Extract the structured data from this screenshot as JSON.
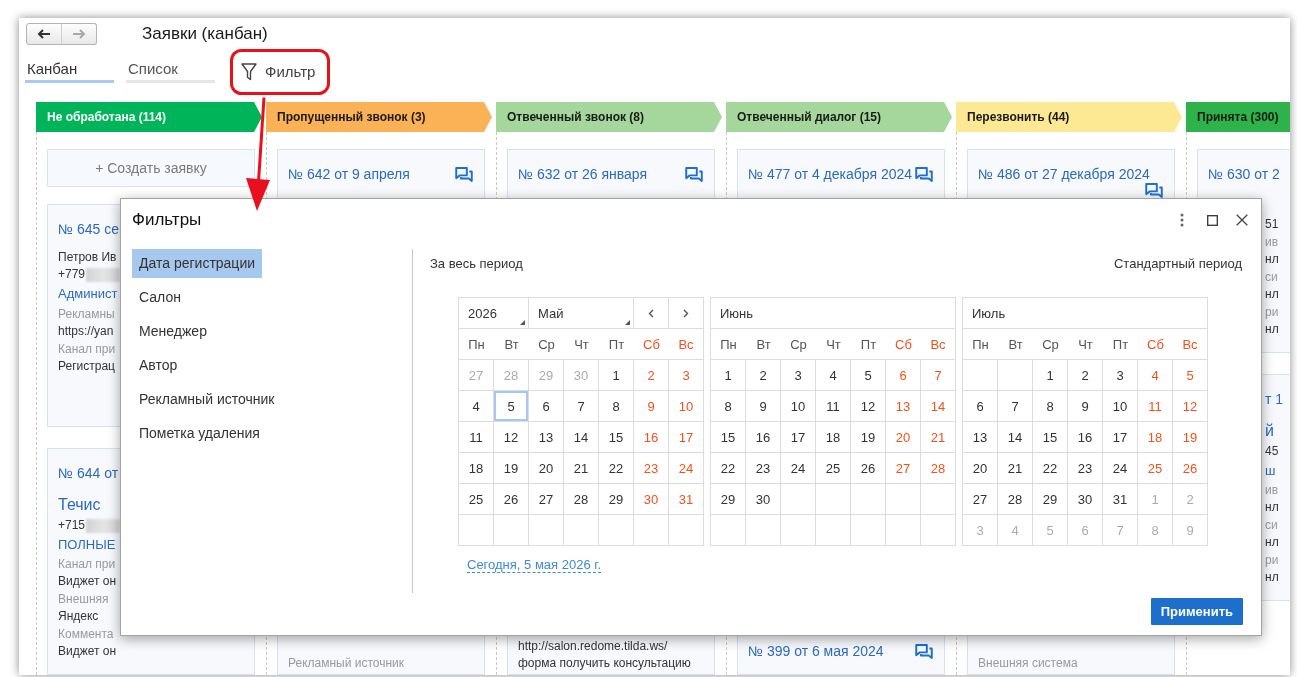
{
  "window": {
    "title": "Заявки (канбан)"
  },
  "nav_buttons": [
    {
      "kind": "back",
      "disabled": false
    },
    {
      "kind": "forward",
      "disabled": true
    }
  ],
  "tabs": [
    {
      "label": "Канбан",
      "selected": true
    },
    {
      "label": "Список",
      "selected": false
    }
  ],
  "filter_button": {
    "label": "Фильтр"
  },
  "columns": [
    {
      "title": "Не обработана (114)",
      "color": "#00b45a",
      "light_text": true,
      "create_button": "+ Создать заявку",
      "cards": [
        {
          "title": "№ 645 се",
          "lines": [
            {
              "kind": "name",
              "text": "Петров Ив"
            },
            {
              "kind": "phone",
              "text": "+779"
            },
            {
              "kind": "link",
              "text": "Админист"
            },
            {
              "kind": "caption",
              "text": "Рекламны"
            },
            {
              "kind": "value",
              "text": "https://yan"
            },
            {
              "kind": "caption",
              "text": "Канал при"
            },
            {
              "kind": "value",
              "text": "Регистрац"
            }
          ]
        },
        {
          "title": "№ 644 от",
          "lines": [
            {
              "kind": "company",
              "text": "Течис"
            },
            {
              "kind": "phone",
              "text": "+715"
            },
            {
              "kind": "tag",
              "text": "ПОЛНЫЕ"
            },
            {
              "kind": "caption",
              "text": "Канал при"
            },
            {
              "kind": "value",
              "text": "Виджет он"
            },
            {
              "kind": "caption",
              "text": "Внешняя"
            },
            {
              "kind": "value",
              "text": "Яндекс"
            },
            {
              "kind": "caption",
              "text": "Коммента"
            },
            {
              "kind": "value",
              "text": "Виджет он"
            }
          ]
        }
      ]
    },
    {
      "title": "Пропущенный звонок (3)",
      "color": "#fbb155",
      "light_text": false,
      "cards": [
        {
          "title": "№ 642 от 9 апреля",
          "chat": true,
          "lines": [
            {
              "kind": "caption",
              "text": "Рекламный источник"
            }
          ]
        }
      ]
    },
    {
      "title": "Отвеченный звонок (8)",
      "color": "#a5d69c",
      "light_text": false,
      "cards": [
        {
          "title": "№ 632 от 26 января",
          "chat": true,
          "lines": [
            {
              "kind": "value",
              "text": "http://salon.redome.tilda.ws/"
            },
            {
              "kind": "value",
              "text": "форма получить консультацию"
            }
          ]
        }
      ]
    },
    {
      "title": "Отвеченный диалог (15)",
      "color": "#a5d69c",
      "light_text": false,
      "cards": [
        {
          "title": "№ 477 от 4 декабря 2024",
          "chat": true
        },
        {
          "title": "№ 399 от 6 мая 2024",
          "chat": true
        }
      ]
    },
    {
      "title": "Перезвонить (44)",
      "color": "#fde994",
      "light_text": false,
      "cards": [
        {
          "title": "№ 486 от 27 декабря 2024",
          "chat": true,
          "lines": [
            {
              "kind": "caption",
              "text": "Внешняя система"
            }
          ]
        }
      ]
    },
    {
      "title": "Принята (300)",
      "color": "#2db34a",
      "light_text": false,
      "cards": [
        {
          "title": "№ 630 от 2",
          "lines": [
            {
              "kind": "value",
              "text": "51"
            },
            {
              "kind": "caption",
              "text": "ив"
            },
            {
              "kind": "value",
              "text": "нл"
            },
            {
              "kind": "caption",
              "text": "си"
            },
            {
              "kind": "value",
              "text": "нл"
            },
            {
              "kind": "caption",
              "text": "ри"
            },
            {
              "kind": "value",
              "text": "нл"
            }
          ]
        },
        {
          "lines": [
            {
              "kind": "title",
              "text": "т 1"
            },
            {
              "kind": "company",
              "text": "й"
            },
            {
              "kind": "value",
              "text": "45"
            },
            {
              "kind": "tag",
              "text": "ш"
            },
            {
              "kind": "caption",
              "text": "ив"
            },
            {
              "kind": "value",
              "text": "нл"
            },
            {
              "kind": "caption",
              "text": "си"
            },
            {
              "kind": "value",
              "text": "нл"
            },
            {
              "kind": "caption",
              "text": "ри"
            },
            {
              "kind": "value",
              "text": "нл"
            }
          ]
        }
      ]
    }
  ],
  "dialog": {
    "title": "Фильтры",
    "sections": [
      {
        "label": "Дата регистрации",
        "selected": true
      },
      {
        "label": "Салон",
        "selected": false
      },
      {
        "label": "Менеджер",
        "selected": false
      },
      {
        "label": "Автор",
        "selected": false
      },
      {
        "label": "Рекламный источник",
        "selected": false
      },
      {
        "label": "Пометка удаления",
        "selected": false
      }
    ],
    "period_all": "За весь период",
    "period_standard": "Стандартный период",
    "months": [
      {
        "kind": "picker",
        "year": "2026",
        "name": "Май",
        "weekdays": [
          {
            "label": "Пн",
            "weekend": false
          },
          {
            "label": "Вт",
            "weekend": false
          },
          {
            "label": "Ср",
            "weekend": false
          },
          {
            "label": "Чт",
            "weekend": false
          },
          {
            "label": "Пт",
            "weekend": false
          },
          {
            "label": "Сб",
            "weekend": true
          },
          {
            "label": "Вс",
            "weekend": true
          }
        ],
        "weeks": [
          [
            {
              "day": "27",
              "muted": true,
              "selected": false
            },
            {
              "day": "28",
              "muted": true,
              "selected": false
            },
            {
              "day": "29",
              "muted": true,
              "selected": false
            },
            {
              "day": "30",
              "muted": true,
              "selected": false
            },
            {
              "day": "1",
              "muted": false,
              "selected": false
            },
            {
              "day": "2",
              "muted": false,
              "selected": false
            },
            {
              "day": "3",
              "muted": false,
              "selected": false
            }
          ],
          [
            {
              "day": "4",
              "muted": false,
              "selected": false
            },
            {
              "day": "5",
              "muted": false,
              "selected": true
            },
            {
              "day": "6",
              "muted": false,
              "selected": false
            },
            {
              "day": "7",
              "muted": false,
              "selected": false
            },
            {
              "day": "8",
              "muted": false,
              "selected": false
            },
            {
              "day": "9",
              "muted": false,
              "selected": false
            },
            {
              "day": "10",
              "muted": false,
              "selected": false
            }
          ],
          [
            {
              "day": "11",
              "muted": false,
              "selected": false
            },
            {
              "day": "12",
              "muted": false,
              "selected": false
            },
            {
              "day": "13",
              "muted": false,
              "selected": false
            },
            {
              "day": "14",
              "muted": false,
              "selected": false
            },
            {
              "day": "15",
              "muted": false,
              "selected": false
            },
            {
              "day": "16",
              "muted": false,
              "selected": false
            },
            {
              "day": "17",
              "muted": false,
              "selected": false
            }
          ],
          [
            {
              "day": "18",
              "muted": false,
              "selected": false
            },
            {
              "day": "19",
              "muted": false,
              "selected": false
            },
            {
              "day": "20",
              "muted": false,
              "selected": false
            },
            {
              "day": "21",
              "muted": false,
              "selected": false
            },
            {
              "day": "22",
              "muted": false,
              "selected": false
            },
            {
              "day": "23",
              "muted": false,
              "selected": false
            },
            {
              "day": "24",
              "muted": false,
              "selected": false
            }
          ],
          [
            {
              "day": "25",
              "muted": false,
              "selected": false
            },
            {
              "day": "26",
              "muted": false,
              "selected": false
            },
            {
              "day": "27",
              "muted": false,
              "selected": false
            },
            {
              "day": "28",
              "muted": false,
              "selected": false
            },
            {
              "day": "29",
              "muted": false,
              "selected": false
            },
            {
              "day": "30",
              "muted": false,
              "selected": false
            },
            {
              "day": "31",
              "muted": false,
              "selected": false
            }
          ]
        ]
      },
      {
        "kind": "plain",
        "name": "Июнь",
        "weekdays": [
          {
            "label": "Пн",
            "weekend": false
          },
          {
            "label": "Вт",
            "weekend": false
          },
          {
            "label": "Ср",
            "weekend": false
          },
          {
            "label": "Чт",
            "weekend": false
          },
          {
            "label": "Пт",
            "weekend": false
          },
          {
            "label": "Сб",
            "weekend": true
          },
          {
            "label": "Вс",
            "weekend": true
          }
        ],
        "weeks": [
          [
            {
              "day": "1",
              "muted": false,
              "selected": false
            },
            {
              "day": "2",
              "muted": false,
              "selected": false
            },
            {
              "day": "3",
              "muted": false,
              "selected": false
            },
            {
              "day": "4",
              "muted": false,
              "selected": false
            },
            {
              "day": "5",
              "muted": false,
              "selected": false
            },
            {
              "day": "6",
              "muted": false,
              "selected": false
            },
            {
              "day": "7",
              "muted": false,
              "selected": false
            }
          ],
          [
            {
              "day": "8",
              "muted": false,
              "selected": false
            },
            {
              "day": "9",
              "muted": false,
              "selected": false
            },
            {
              "day": "10",
              "muted": false,
              "selected": false
            },
            {
              "day": "11",
              "muted": false,
              "selected": false
            },
            {
              "day": "12",
              "muted": false,
              "selected": false
            },
            {
              "day": "13",
              "muted": false,
              "selected": false
            },
            {
              "day": "14",
              "muted": false,
              "selected": false
            }
          ],
          [
            {
              "day": "15",
              "muted": false,
              "selected": false
            },
            {
              "day": "16",
              "muted": false,
              "selected": false
            },
            {
              "day": "17",
              "muted": false,
              "selected": false
            },
            {
              "day": "18",
              "muted": false,
              "selected": false
            },
            {
              "day": "19",
              "muted": false,
              "selected": false
            },
            {
              "day": "20",
              "muted": false,
              "selected": false
            },
            {
              "day": "21",
              "muted": false,
              "selected": false
            }
          ],
          [
            {
              "day": "22",
              "muted": false,
              "selected": false
            },
            {
              "day": "23",
              "muted": false,
              "selected": false
            },
            {
              "day": "24",
              "muted": false,
              "selected": false
            },
            {
              "day": "25",
              "muted": false,
              "selected": false
            },
            {
              "day": "26",
              "muted": false,
              "selected": false
            },
            {
              "day": "27",
              "muted": false,
              "selected": false
            },
            {
              "day": "28",
              "muted": false,
              "selected": false
            }
          ],
          [
            {
              "day": "29",
              "muted": false,
              "selected": false
            },
            {
              "day": "30",
              "muted": false,
              "selected": false
            }
          ]
        ]
      },
      {
        "kind": "plain",
        "name": "Июль",
        "weekdays": [
          {
            "label": "Пн",
            "weekend": false
          },
          {
            "label": "Вт",
            "weekend": false
          },
          {
            "label": "Ср",
            "weekend": false
          },
          {
            "label": "Чт",
            "weekend": false
          },
          {
            "label": "Пт",
            "weekend": false
          },
          {
            "label": "Сб",
            "weekend": true
          },
          {
            "label": "Вс",
            "weekend": true
          }
        ],
        "weeks": [
          [
            {
              "day": "1",
              "muted": false,
              "selected": false
            },
            {
              "day": "2",
              "muted": false,
              "selected": false
            },
            {
              "day": "3",
              "muted": false,
              "selected": false
            },
            {
              "day": "4",
              "muted": false,
              "selected": false
            },
            {
              "day": "5",
              "muted": false,
              "selected": false
            }
          ],
          [
            {
              "day": "6",
              "muted": false,
              "selected": false
            },
            {
              "day": "7",
              "muted": false,
              "selected": false
            },
            {
              "day": "8",
              "muted": false,
              "selected": false
            },
            {
              "day": "9",
              "muted": false,
              "selected": false
            },
            {
              "day": "10",
              "muted": false,
              "selected": false
            },
            {
              "day": "11",
              "muted": false,
              "selected": false
            },
            {
              "day": "12",
              "muted": false,
              "selected": false
            }
          ],
          [
            {
              "day": "13",
              "muted": false,
              "selected": false
            },
            {
              "day": "14",
              "muted": false,
              "selected": false
            },
            {
              "day": "15",
              "muted": false,
              "selected": false
            },
            {
              "day": "16",
              "muted": false,
              "selected": false
            },
            {
              "day": "17",
              "muted": false,
              "selected": false
            },
            {
              "day": "18",
              "muted": false,
              "selected": false
            },
            {
              "day": "19",
              "muted": false,
              "selected": false
            }
          ],
          [
            {
              "day": "20",
              "muted": false,
              "selected": false
            },
            {
              "day": "21",
              "muted": false,
              "selected": false
            },
            {
              "day": "22",
              "muted": false,
              "selected": false
            },
            {
              "day": "23",
              "muted": false,
              "selected": false
            },
            {
              "day": "24",
              "muted": false,
              "selected": false
            },
            {
              "day": "25",
              "muted": false,
              "selected": false
            },
            {
              "day": "26",
              "muted": false,
              "selected": false
            }
          ],
          [
            {
              "day": "27",
              "muted": false,
              "selected": false
            },
            {
              "day": "28",
              "muted": false,
              "selected": false
            },
            {
              "day": "29",
              "muted": false,
              "selected": false
            },
            {
              "day": "30",
              "muted": false,
              "selected": false
            },
            {
              "day": "31",
              "muted": false,
              "selected": false
            },
            {
              "day": "1",
              "muted": true,
              "selected": false
            },
            {
              "day": "2",
              "muted": true,
              "selected": false
            }
          ],
          [
            {
              "day": "3",
              "muted": true,
              "selected": false
            },
            {
              "day": "4",
              "muted": true,
              "selected": false
            },
            {
              "day": "5",
              "muted": true,
              "selected": false
            },
            {
              "day": "6",
              "muted": true,
              "selected": false
            },
            {
              "day": "7",
              "muted": true,
              "selected": false
            },
            {
              "day": "8",
              "muted": true,
              "selected": false
            },
            {
              "day": "9",
              "muted": true,
              "selected": false
            }
          ]
        ]
      }
    ],
    "today_link": "Сегодня, 5 мая 2026 г.",
    "apply_button": "Применить"
  }
}
